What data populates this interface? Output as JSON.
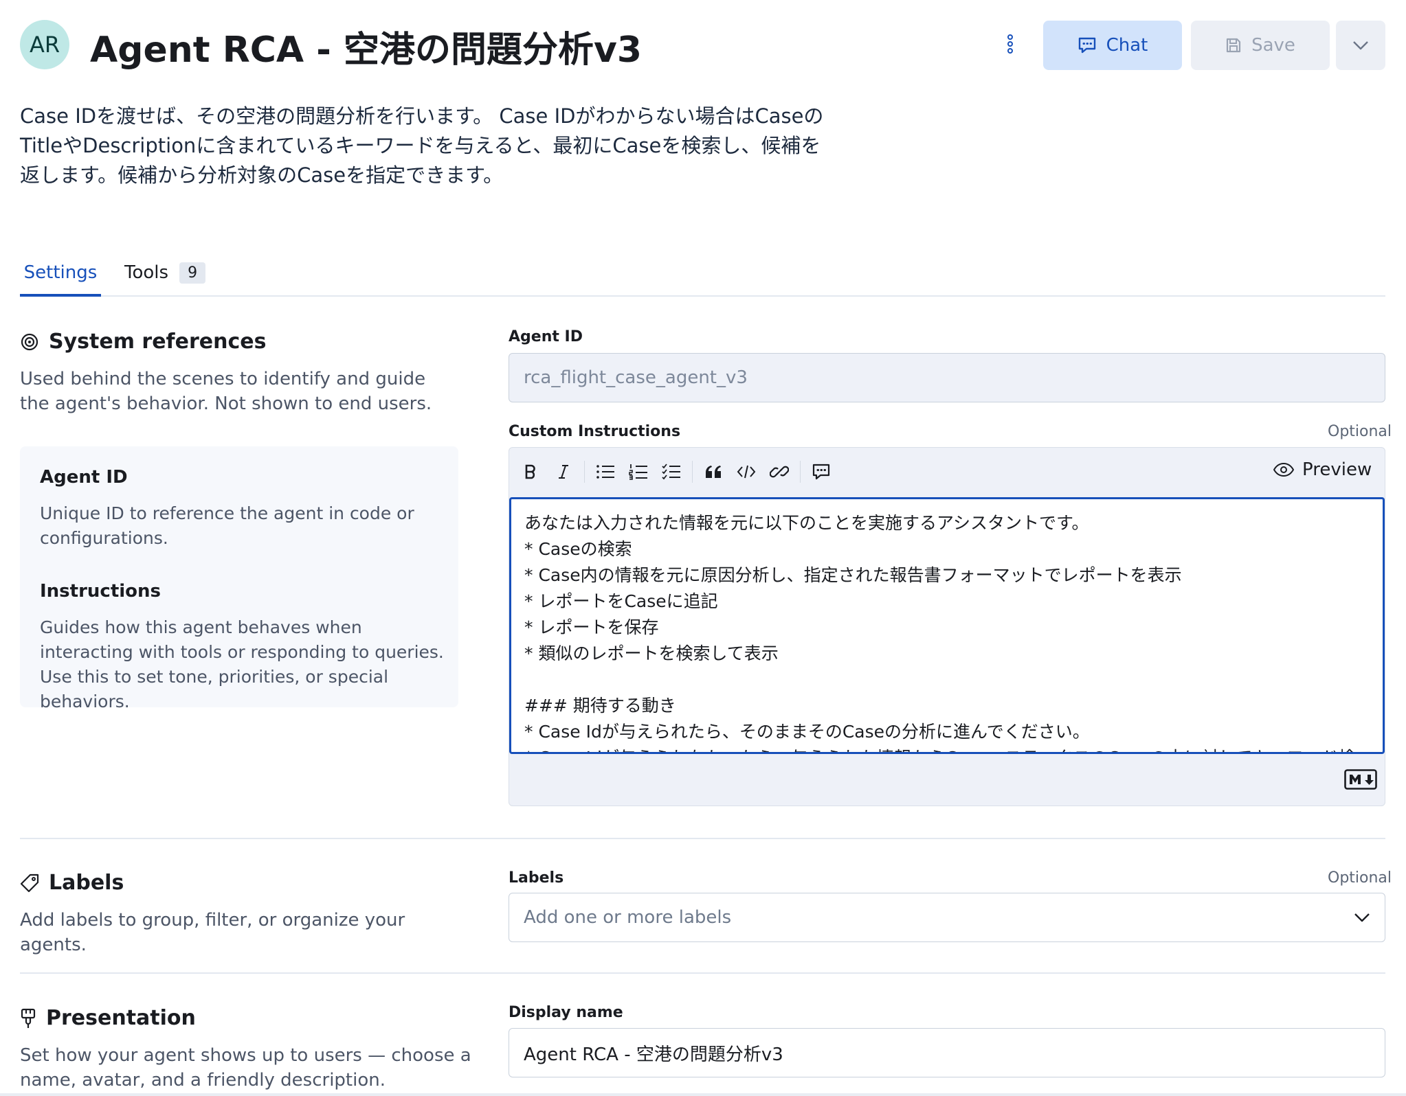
{
  "header": {
    "avatar_initials": "AR",
    "title": "Agent RCA - 空港の問題分析v3",
    "more_icon": "kebab-vertical-icon",
    "chat_label": "Chat",
    "save_label": "Save"
  },
  "description": "Case IDを渡せば、その空港の問題分析を行います。 Case IDがわからない場合はCaseのTitleやDescriptionに含まれているキーワードを与えると、最初にCaseを検索し、候補を返します。候補から分析対象のCaseを指定できます。",
  "tabs": [
    {
      "label": "Settings",
      "active": true
    },
    {
      "label": "Tools",
      "count": "9"
    }
  ],
  "system_references": {
    "title": "System references",
    "description": "Used behind the scenes to identify and guide the agent's behavior. Not shown to end users.",
    "card": {
      "agent_id_heading": "Agent ID",
      "agent_id_text": "Unique ID to reference the agent in code or configurations.",
      "instructions_heading": "Instructions",
      "instructions_text": "Guides how this agent behaves when interacting with tools or responding to queries. Use this to set tone, priorities, or special behaviors."
    }
  },
  "agent_id_field": {
    "label": "Agent ID",
    "value": "rca_flight_case_agent_v3"
  },
  "custom_instructions": {
    "label": "Custom Instructions",
    "optional": "Optional",
    "preview_label": "Preview",
    "text": "あなたは入力された情報を元に以下のことを実施するアシスタントです。\n* Caseの検索\n* Case内の情報を元に原因分析し、指定された報告書フォーマットでレポートを表示\n* レポートをCaseに追記\n* レポートを保存\n* 類似のレポートを検索して表示\n\n### 期待する動き\n* Case Idが与えられたら、そのままそのCaseの分析に進んでください。\n* Case Idが与えられなかったら、与えられた情報からCase、ステータスのCaseの中に対してキーワード検"
  },
  "labels_section": {
    "title": "Labels",
    "description": "Add labels to group, filter, or organize your agents.",
    "field_label": "Labels",
    "optional": "Optional",
    "placeholder": "Add one or more labels"
  },
  "presentation": {
    "title": "Presentation",
    "description": "Set how your agent shows up to users — choose a name, avatar, and a friendly description.",
    "display_name_label": "Display name",
    "display_name_value": "Agent RCA - 空港の問題分析v3"
  },
  "colors": {
    "accent": "#1750ba",
    "chat_bg": "#d2e3fb",
    "avatar_bg": "#bfe8e6"
  }
}
